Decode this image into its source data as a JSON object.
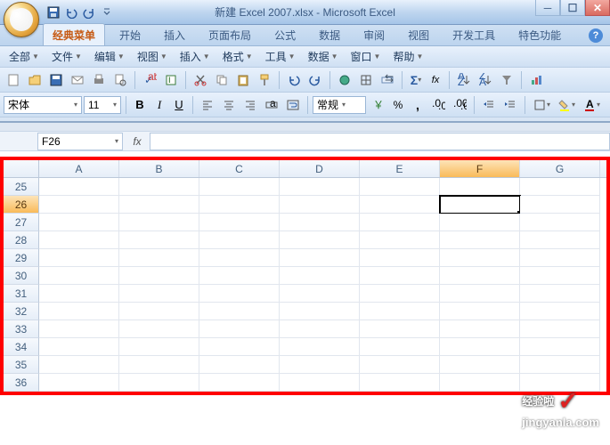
{
  "window": {
    "title": "新建 Excel 2007.xlsx - Microsoft Excel"
  },
  "ribbon_tabs": {
    "classic": "经典菜单",
    "home": "开始",
    "insert": "插入",
    "page_layout": "页面布局",
    "formulas": "公式",
    "data": "数据",
    "review": "审阅",
    "view": "视图",
    "developer": "开发工具",
    "special": "特色功能"
  },
  "menus": {
    "all": "全部",
    "file": "文件",
    "edit": "编辑",
    "view": "视图",
    "insert": "插入",
    "format": "格式",
    "tools": "工具",
    "data": "数据",
    "window": "窗口",
    "help": "帮助"
  },
  "font": {
    "name": "宋体",
    "size": "11"
  },
  "number_format": "常规",
  "namebox": "F26",
  "columns": [
    "A",
    "B",
    "C",
    "D",
    "E",
    "F",
    "G"
  ],
  "rows": [
    25,
    26,
    27,
    28,
    29,
    30,
    31,
    32,
    33,
    34,
    35,
    36
  ],
  "selected": {
    "col": "F",
    "row": 26
  },
  "watermark": {
    "line1": "经验啦",
    "line2": "jingyanla.com"
  },
  "icons": {
    "bold": "B",
    "italic": "I",
    "underline": "U",
    "sum": "Σ",
    "fx_small": "fx",
    "help": "?"
  }
}
